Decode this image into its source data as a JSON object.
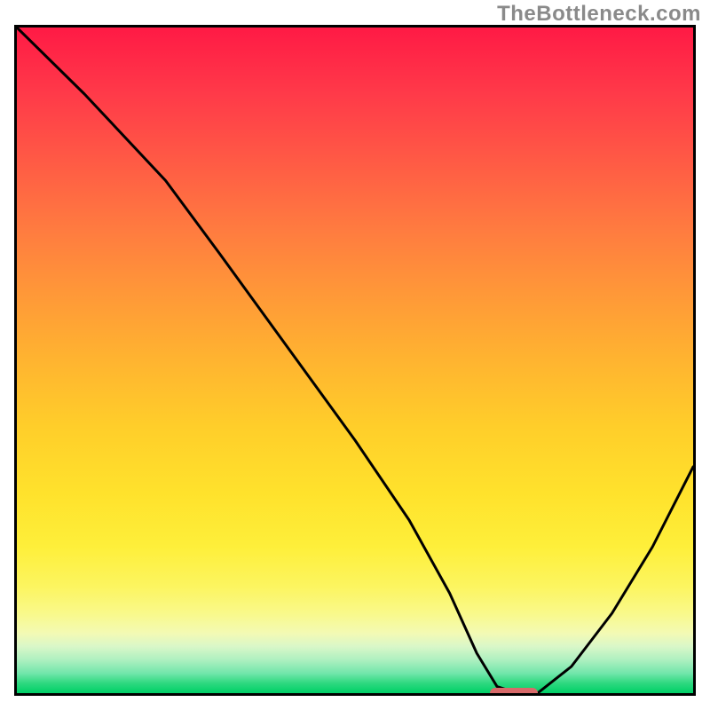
{
  "watermark": "TheBottleneck.com",
  "chart_data": {
    "type": "line",
    "title": "",
    "xlabel": "",
    "ylabel": "",
    "xlim": [
      0,
      100
    ],
    "ylim": [
      0,
      100
    ],
    "grid": false,
    "series": [
      {
        "name": "bottleneck-curve",
        "x": [
          0,
          10,
          22,
          30,
          40,
          50,
          58,
          64,
          68,
          71,
          74,
          77,
          82,
          88,
          94,
          100
        ],
        "y": [
          100,
          90,
          77,
          66,
          52,
          38,
          26,
          15,
          6,
          1,
          0,
          0,
          4,
          12,
          22,
          34
        ]
      }
    ],
    "minimum_marker": {
      "x_start": 70,
      "x_end": 77,
      "color": "#d86a6a"
    },
    "gradient": {
      "top_color": "#ff1a45",
      "mid_color": "#ffe22c",
      "bottom_color": "#00cf66"
    }
  }
}
